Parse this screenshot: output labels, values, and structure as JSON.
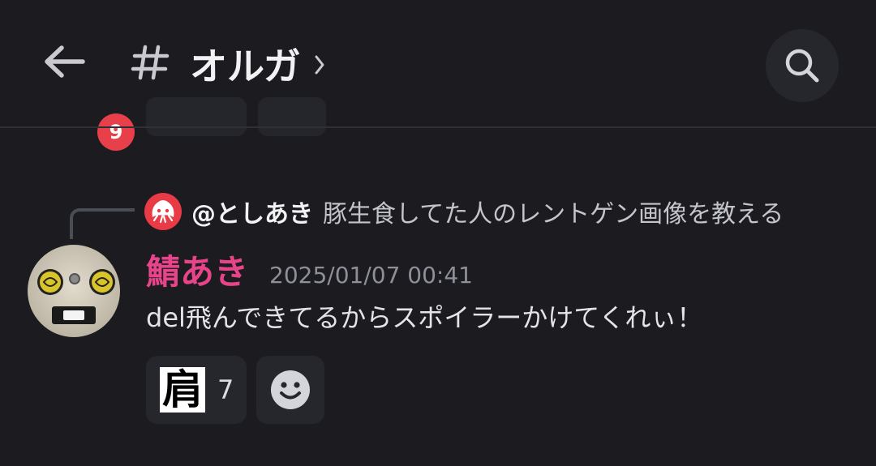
{
  "header": {
    "unread_count": "9",
    "channel_name": "オルガ",
    "channel_chevron": "›"
  },
  "reply": {
    "author": "@としあき",
    "text": "豚生食してた人のレントゲン画像を教える"
  },
  "message": {
    "author": "鯖あき",
    "author_color": "#e8448a",
    "timestamp": "2025/01/07 00:41",
    "text": "del飛んできてるからスポイラーかけてくれぃ！"
  },
  "reactions": [
    {
      "emoji": "肩",
      "count": "7"
    }
  ],
  "icons": {
    "back": "arrow-left-icon",
    "channel": "hash-icon",
    "search": "search-icon",
    "add_reaction": "smiley-face-icon"
  },
  "colors": {
    "background": "#1b1b20",
    "badge": "#e8404a",
    "surface": "#26272d"
  }
}
